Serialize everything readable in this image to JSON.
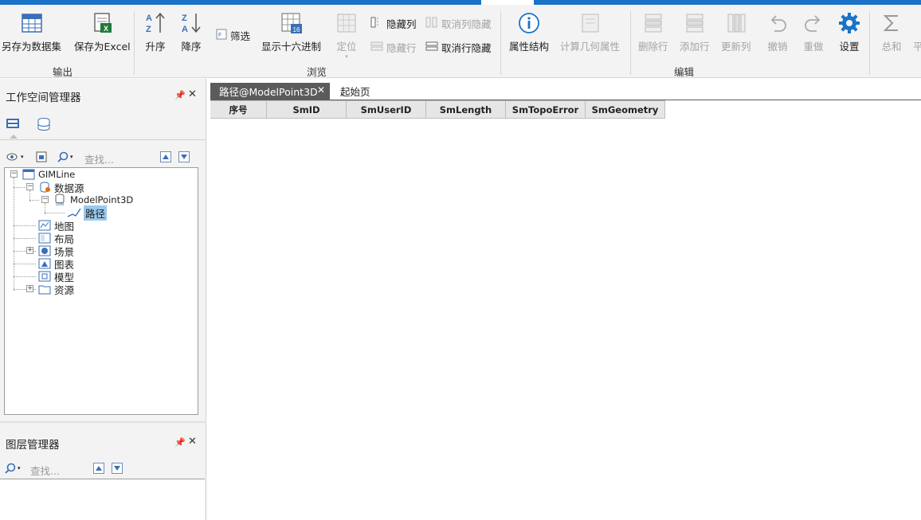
{
  "ribbon": {
    "output": {
      "group_label": "输出",
      "save_dataset": "另存为数据集",
      "save_excel": "保存为Excel"
    },
    "browse": {
      "group_label": "浏览",
      "sort_asc": "升序",
      "sort_desc": "降序",
      "filter": "筛选",
      "show_hex": "显示十六进制",
      "locate": "定位",
      "hide_column": "隐藏列",
      "unhide_column": "取消列隐藏",
      "hide_row": "隐藏行",
      "unhide_row": "取消行隐藏"
    },
    "edit": {
      "group_label": "编辑",
      "attr_structure": "属性结构",
      "calc_geometry": "计算几何属性",
      "delete_row": "删除行",
      "add_row": "添加行",
      "update_column": "更新列",
      "undo": "撤销",
      "redo": "重做",
      "settings": "设置"
    },
    "stats": {
      "sum": "总和",
      "avg_partial": "平"
    }
  },
  "workspace": {
    "title": "工作空间管理器",
    "search_placeholder": "查找...",
    "tree": {
      "root": "GIMLine",
      "datasource": "数据源",
      "model_point": "ModelPoint3D",
      "dataset": "路径",
      "map": "地图",
      "layout": "布局",
      "scene": "场景",
      "chart": "图表",
      "model": "模型",
      "resource": "资源"
    }
  },
  "layers": {
    "title": "图层管理器",
    "search_placeholder": "查找..."
  },
  "tabs": {
    "active": "路径@ModelPoint3D",
    "start": "起始页"
  },
  "grid": {
    "columns": [
      "序号",
      "SmID",
      "SmUserID",
      "SmLength",
      "SmTopoError",
      "SmGeometry"
    ]
  },
  "colors": {
    "accent": "#1a73c9",
    "selection": "#99c9ef",
    "disabled": "#a3a3a3"
  }
}
